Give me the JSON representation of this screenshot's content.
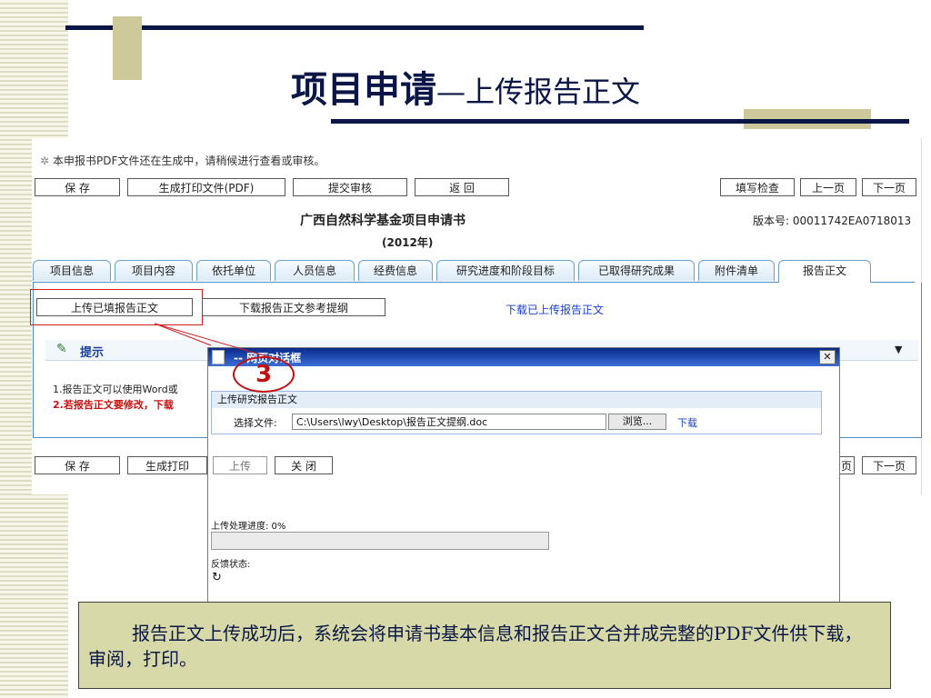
{
  "slide": {
    "title_main": "项目申请",
    "title_sub": "—上传报告正文",
    "caption": "报告正文上传成功后，系统会将申请书基本信息和报告正文合并成完整的PDF文件供下载，审阅，打印。",
    "step_marker": "3"
  },
  "app": {
    "notice": "本申报书PDF文件还在生成中，请稍候进行查看或审核。",
    "toolbar": {
      "save": "保 存",
      "generate_pdf": "生成打印文件(PDF)",
      "submit": "提交审核",
      "back": "返 回",
      "check": "填写检查",
      "prev": "上一页",
      "next": "下一页"
    },
    "bottom_toolbar": {
      "save": "保 存",
      "generate_pdf": "生成打印",
      "prev_partial": "页",
      "next": "下一页"
    },
    "doc_title": "广西自然科学基金项目申请书",
    "doc_year": "(2012年)",
    "version": "版本号: 00011742EA0718013",
    "tabs": [
      "项目信息",
      "项目内容",
      "依托单位",
      "人员信息",
      "经费信息",
      "研究进度和阶段目标",
      "已取得研究成果",
      "附件清单",
      "报告正文"
    ],
    "active_tab": 8,
    "actions": {
      "upload_filled": "上传已填报告正文",
      "download_outline": "下载报告正文参考提纲",
      "download_uploaded": "下载已上传报告正文"
    },
    "hint": {
      "title": "提示",
      "line1": "1.报告正文可以使用Word或",
      "line2": "2.若报告正文要修改，下载"
    },
    "dialog": {
      "title": "-- 网页对话框",
      "section_title": "上传研究报告正文",
      "file_label": "选择文件:",
      "file_value": "C:\\Users\\lwy\\Desktop\\报告正文提纲.doc",
      "browse": "浏览...",
      "download": "下载",
      "upload": "上传",
      "close": "关 闭",
      "progress_label": "上传处理进度: 0%",
      "progress": 0,
      "status_label": "反馈状态:"
    }
  }
}
